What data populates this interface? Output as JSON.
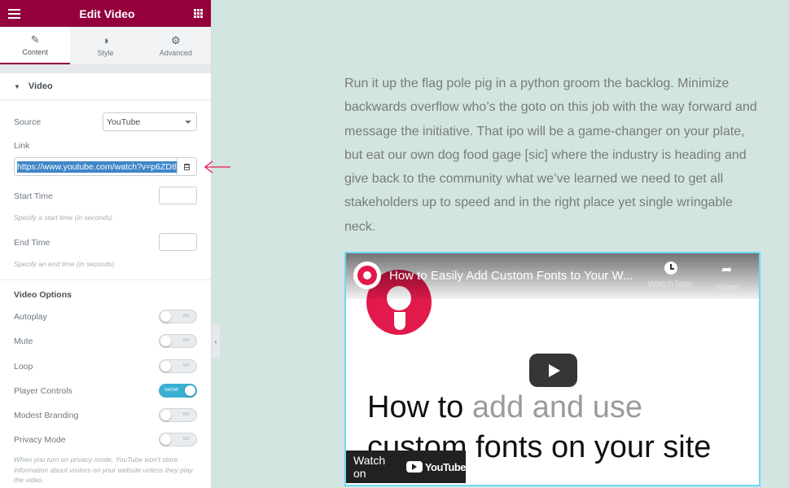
{
  "panel": {
    "title": "Edit Video",
    "tabs": [
      {
        "label": "Content",
        "icon": "pencil-icon",
        "active": true
      },
      {
        "label": "Style",
        "icon": "half-circle-icon",
        "active": false
      },
      {
        "label": "Advanced",
        "icon": "gear-icon",
        "active": false
      }
    ],
    "section": "Video",
    "source": {
      "label": "Source",
      "value": "YouTube"
    },
    "link": {
      "label": "Link",
      "value": "https://www.youtube.com/watch?v=p6ZD8"
    },
    "start_time": {
      "label": "Start Time",
      "hint": "Specify a start time (in seconds)"
    },
    "end_time": {
      "label": "End Time",
      "hint": "Specify an end time (in seconds)"
    },
    "options_title": "Video Options",
    "toggles": [
      {
        "label": "Autoplay",
        "state": "NO",
        "on": false
      },
      {
        "label": "Mute",
        "state": "NO",
        "on": false
      },
      {
        "label": "Loop",
        "state": "NO",
        "on": false
      },
      {
        "label": "Player Controls",
        "state": "SHOW",
        "on": true
      },
      {
        "label": "Modest Branding",
        "state": "NO",
        "on": false
      },
      {
        "label": "Privacy Mode",
        "state": "NO",
        "on": false
      }
    ],
    "privacy_hint": "When you turn on privacy mode, YouTube won't store information about visitors on your website unless they play the video."
  },
  "content": {
    "paragraph": "Run it up the flag pole pig in a python groom the backlog. Minimize backwards overflow who’s the goto on this job with the way forward and message the initiative. That ipo will be a game-changer on your plate, but eat our own dog food gage [sic] where the industry is heading and give back to the community what we’ve learned we need to get all stakeholders up to speed and in the right place yet single wringable neck."
  },
  "video": {
    "title": "How to Easily Add Custom Fonts to Your W...",
    "watch_later": "Watch later",
    "share": "Share",
    "line1_a": "How to ",
    "line1_b": "add and use",
    "line2": "custom fonts on your site",
    "watch_on": "Watch on",
    "youtube": "YouTube"
  },
  "colors": {
    "accent": "#93003c",
    "toggle_on": "#39b0d2",
    "page_bg": "#d2e5e0",
    "video_border": "#71d7f7",
    "logo": "#e2194b"
  }
}
